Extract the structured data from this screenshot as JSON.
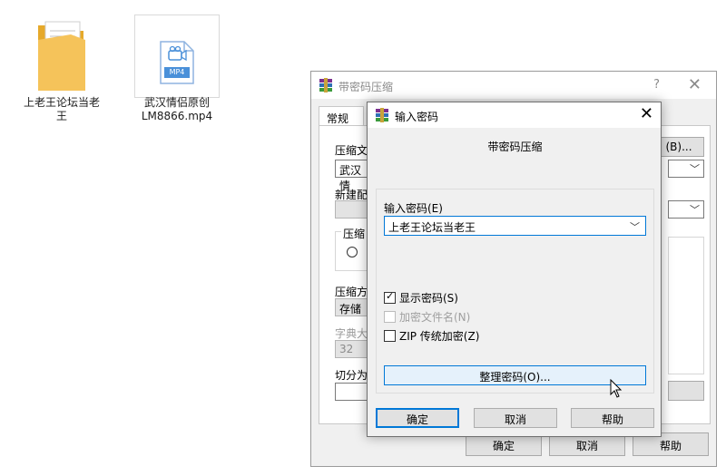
{
  "desktop": {
    "icons": [
      {
        "label": "上老王论坛当老王",
        "type": "folder-icon"
      },
      {
        "label": "武汉情侣原创LM8866.mp4",
        "type": "video-file-icon",
        "badge": "MP4"
      }
    ]
  },
  "background_dialog": {
    "title": "带密码压缩",
    "help": "?",
    "close": "✕",
    "tab": "常规",
    "fields": {
      "archive_label": "压缩文",
      "archive_value": "武汉情",
      "browse_button": "(B)...",
      "profile_label": "新建配",
      "format_label": "压缩",
      "method_label": "压缩方",
      "method_value": "存储",
      "dict_label": "字典大",
      "dict_value": "32",
      "split_label": "切分为"
    },
    "buttons": {
      "ok": "确定",
      "cancel": "取消",
      "help": "帮助"
    }
  },
  "password_dialog": {
    "title": "输入密码",
    "close": "✕",
    "heading": "带密码压缩",
    "password_label": "输入密码(E)",
    "password_value": "上老王论坛当老王",
    "options": [
      {
        "label": "显示密码(S)",
        "checked": true,
        "enabled": true
      },
      {
        "label": "加密文件名(N)",
        "checked": false,
        "enabled": false
      },
      {
        "label": "ZIP 传统加密(Z)",
        "checked": false,
        "enabled": true
      }
    ],
    "organize_button": "整理密码(O)...",
    "buttons": {
      "ok": "确定",
      "cancel": "取消",
      "help": "帮助"
    }
  },
  "colors": {
    "accent": "#0078d7",
    "dialog_bg": "#f0f0f0",
    "folder": "#f5c35a",
    "video_blue": "#4a90d9"
  }
}
